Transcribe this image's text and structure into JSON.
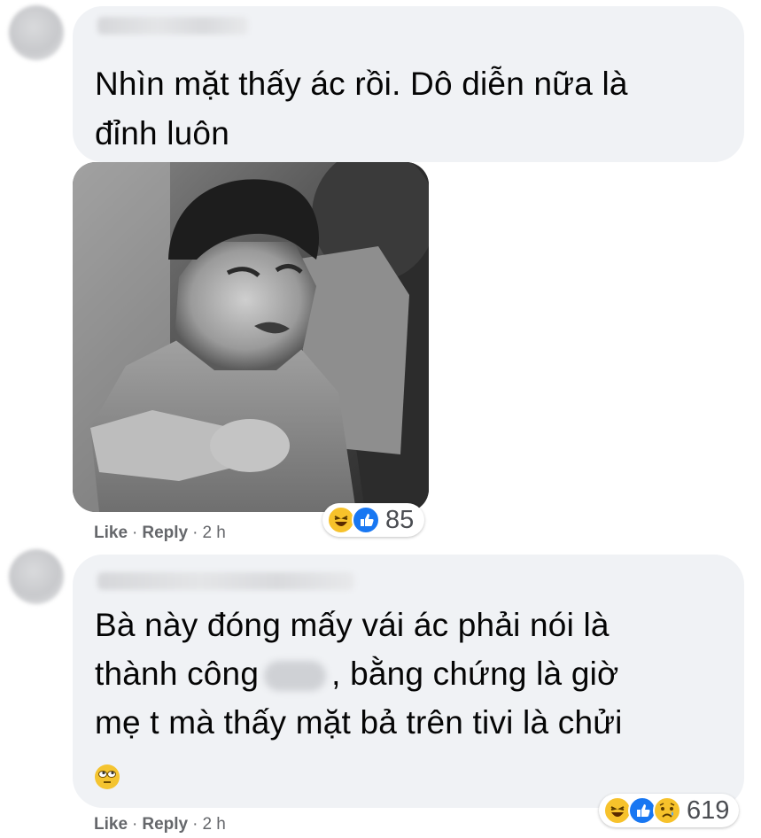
{
  "comments": [
    {
      "author": "",
      "lines": [
        "Nhìn mặt thấy ác rồi. Dô diễn nữa là",
        "đỉnh luôn"
      ],
      "reactions": {
        "icons": [
          "haha-icon",
          "like-icon"
        ],
        "count": "85"
      },
      "actions": {
        "like": "Like",
        "reply": "Reply",
        "time": "2 h"
      }
    },
    {
      "author": "",
      "line1": "Bà này đóng mấy vái ác phải nói là",
      "line2_before": "thành công",
      "line2_after": ", bằng chứng là giờ",
      "line3": "mẹ t mà thấy mặt bả trên tivi là chửi",
      "reactions": {
        "icons": [
          "haha-icon",
          "like-icon",
          "sad-icon"
        ],
        "count": "619"
      },
      "actions": {
        "like": "Like",
        "reply": "Reply",
        "time": "2 h"
      }
    }
  ],
  "colors": {
    "bubble": "#f0f2f5",
    "meta": "#65676b",
    "like": "#1877f2",
    "haha": "#f7c22b"
  }
}
